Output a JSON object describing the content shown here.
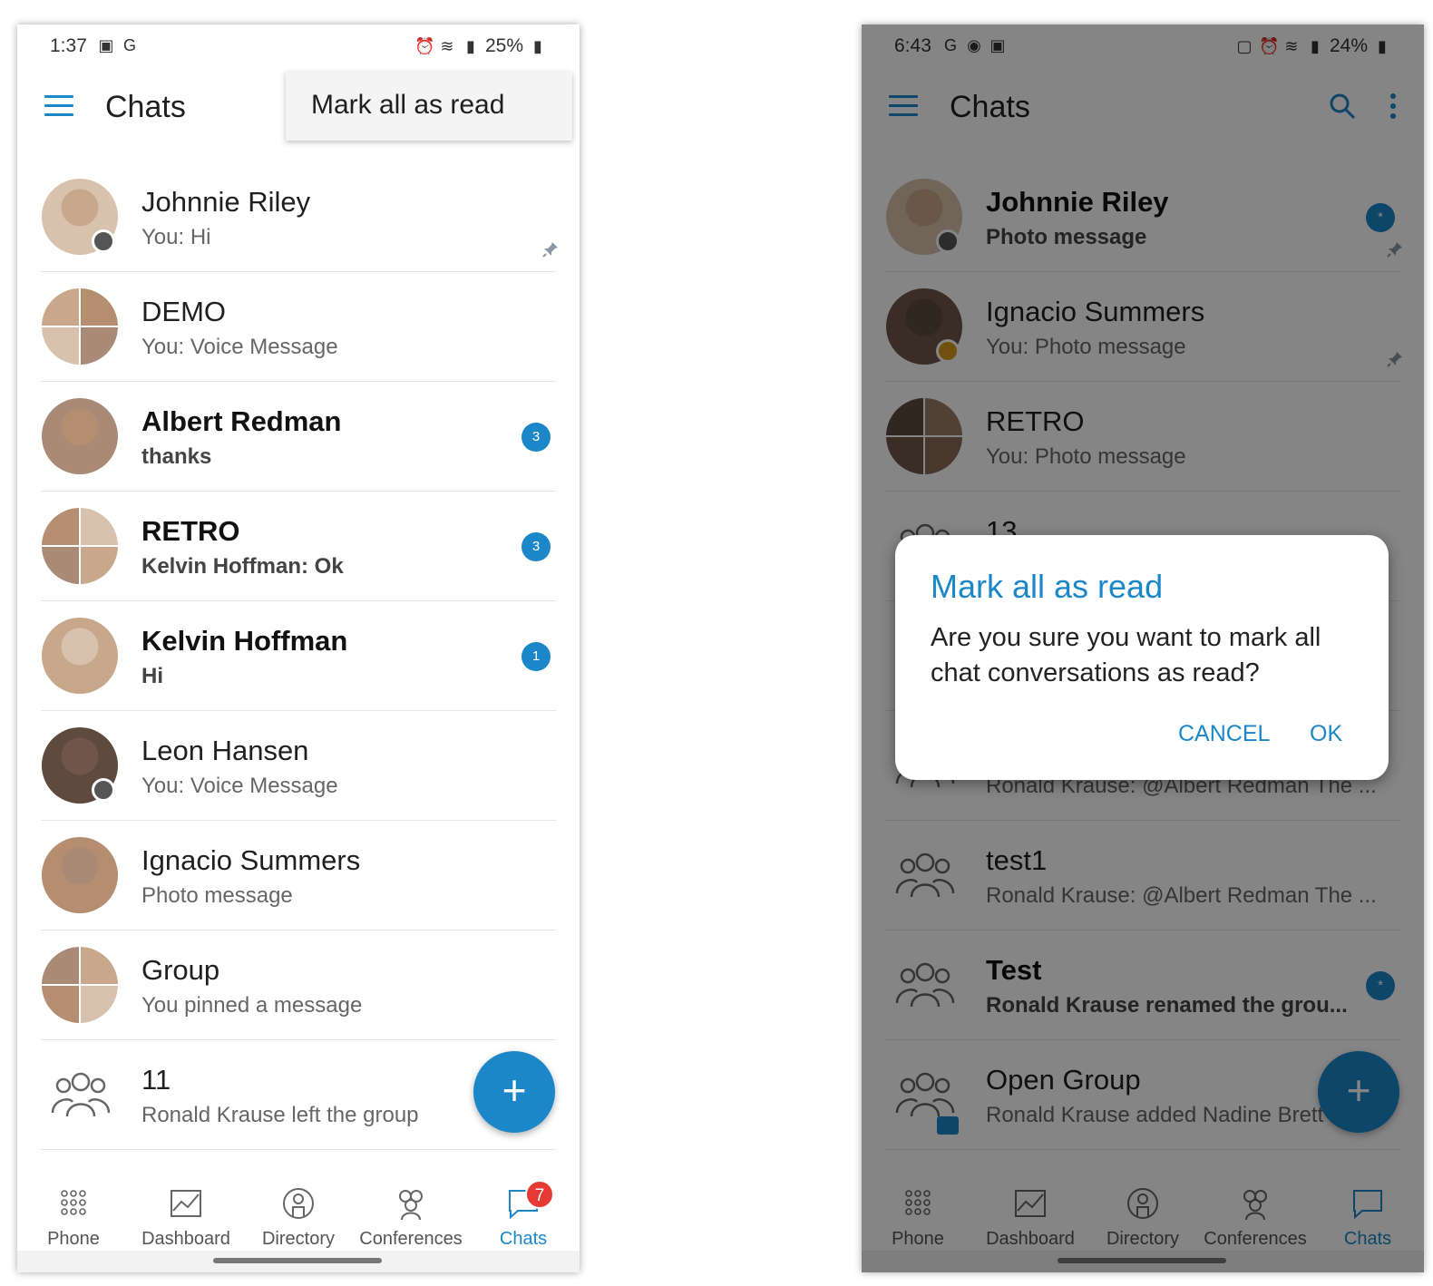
{
  "colors": {
    "accent": "#1b87c9",
    "badge_red": "#e53935",
    "presence": "#555555",
    "away": "#d99a1a"
  },
  "left": {
    "status": {
      "time": "1:37",
      "battery": "25%",
      "icons": [
        "gallery-icon",
        "g-icon",
        "alarm-icon",
        "wifi-icon",
        "signal-icon",
        "battery-icon"
      ]
    },
    "appbar": {
      "title": "Chats",
      "menu_item": "Mark all as read"
    },
    "chats": [
      {
        "name": "Johnnie Riley",
        "preview": "You: Hi",
        "unread": false,
        "pinned": true,
        "presence": "offline"
      },
      {
        "name": "DEMO",
        "preview": "You: Voice Message",
        "unread": false,
        "group_avatar": true
      },
      {
        "name": "Albert Redman",
        "preview": "thanks",
        "unread": true,
        "badge": "3"
      },
      {
        "name": "RETRO",
        "preview": "Kelvin Hoffman: Ok",
        "unread": true,
        "badge": "3",
        "group_avatar": true
      },
      {
        "name": "Kelvin Hoffman",
        "preview": "Hi",
        "unread": true,
        "badge": "1"
      },
      {
        "name": "Leon Hansen",
        "preview": "You: Voice Message",
        "unread": false,
        "presence": "offline"
      },
      {
        "name": "Ignacio Summers",
        "preview": "Photo message",
        "unread": false
      },
      {
        "name": "Group",
        "preview": "You pinned a message",
        "unread": false,
        "group_avatar": true
      },
      {
        "name": "11",
        "preview": "Ronald Krause left the group",
        "unread": false,
        "group_icon": true
      }
    ],
    "fab": "+",
    "nav": [
      {
        "label": "Phone",
        "icon": "dialpad-icon"
      },
      {
        "label": "Dashboard",
        "icon": "dashboard-icon"
      },
      {
        "label": "Directory",
        "icon": "directory-icon"
      },
      {
        "label": "Conferences",
        "icon": "conferences-icon"
      },
      {
        "label": "Chats",
        "icon": "chat-icon",
        "active": true,
        "badge": "7"
      }
    ]
  },
  "right": {
    "status": {
      "time": "6:43",
      "battery": "24%",
      "icons": [
        "g-icon",
        "location-icon",
        "gallery-icon",
        "lock-icon",
        "alarm-icon",
        "wifi-icon",
        "signal-icon",
        "battery-icon"
      ]
    },
    "appbar": {
      "title": "Chats"
    },
    "chats": [
      {
        "name": "Johnnie Riley",
        "preview": "Photo message",
        "unread": true,
        "pinned": true,
        "presence": "offline",
        "badge": "*"
      },
      {
        "name": "Ignacio Summers",
        "preview": "You: Photo message",
        "unread": false,
        "pinned": true,
        "presence": "away"
      },
      {
        "name": "RETRO",
        "preview": "You: Photo message",
        "unread": false,
        "group_avatar": true
      },
      {
        "name": "13",
        "preview": "",
        "unread": false,
        "group_icon": true
      },
      {
        "name": "",
        "preview": "",
        "unread": false
      },
      {
        "name": "",
        "preview": "Ronald Krause: @Albert Redman The ...",
        "unread": false,
        "group_icon": true
      },
      {
        "name": "test1",
        "preview": "Ronald Krause: @Albert Redman The ...",
        "unread": false,
        "group_icon": true
      },
      {
        "name": "Test",
        "preview": "Ronald Krause renamed the grou...",
        "unread": true,
        "badge": "*",
        "group_icon": true
      },
      {
        "name": "Open Group",
        "preview": "Ronald Krause added Nadine Brett",
        "unread": false,
        "group_icon": true,
        "share": true
      }
    ],
    "dialog": {
      "title": "Mark all as read",
      "message": "Are you sure you want to mark all chat conversations as read?",
      "cancel": "CANCEL",
      "ok": "OK"
    },
    "fab": "+",
    "nav": [
      {
        "label": "Phone",
        "icon": "dialpad-icon"
      },
      {
        "label": "Dashboard",
        "icon": "dashboard-icon"
      },
      {
        "label": "Directory",
        "icon": "directory-icon"
      },
      {
        "label": "Conferences",
        "icon": "conferences-icon"
      },
      {
        "label": "Chats",
        "icon": "chat-icon",
        "active": true
      }
    ]
  }
}
